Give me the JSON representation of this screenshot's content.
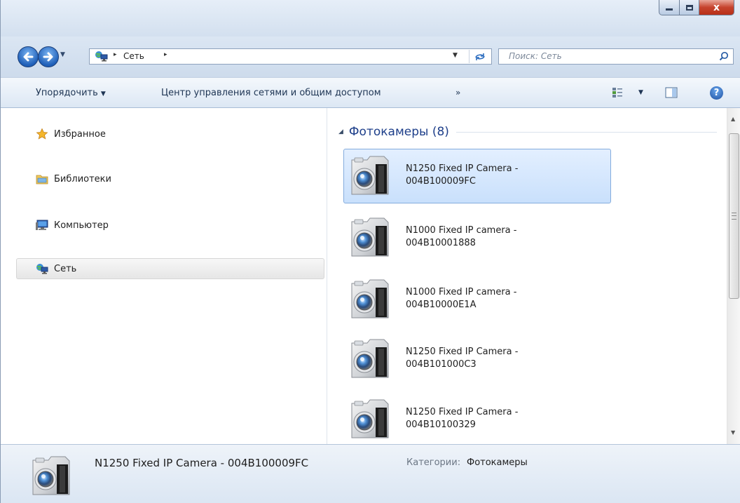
{
  "window": {
    "caption": {
      "minimize": "minimize",
      "maximize": "maximize",
      "close": "x"
    }
  },
  "navigation": {
    "back_icon": "arrow-left-icon",
    "forward_icon": "arrow-right-icon",
    "address": {
      "location": "Сеть",
      "separator": "▸"
    },
    "search": {
      "placeholder": "Поиск: Сеть"
    }
  },
  "toolbar": {
    "organize_label": "Упорядочить",
    "organize_arrow": "▼",
    "network_center_label": "Центр управления сетями и общим доступом",
    "more_label": "»",
    "view_arrow": "▼",
    "help_label": "?"
  },
  "nav_pane": {
    "items": [
      {
        "label": "Избранное",
        "icon": "star-icon"
      },
      {
        "label": "Библиотеки",
        "icon": "library-folder-icon"
      },
      {
        "label": "Компьютер",
        "icon": "computer-icon"
      },
      {
        "label": "Сеть",
        "icon": "network-icon",
        "selected": true
      }
    ]
  },
  "content": {
    "group": {
      "collapse_glyph": "◢",
      "title": "Фотокамеры (8)"
    },
    "items": [
      {
        "line1": "N1250 Fixed IP Camera -",
        "line2": "004B100009FC",
        "selected": true
      },
      {
        "line1": "N1000 Fixed IP camera -",
        "line2": "004B10001888",
        "selected": false
      },
      {
        "line1": "N1000 Fixed IP camera -",
        "line2": "004B10000E1A",
        "selected": false
      },
      {
        "line1": "N1250 Fixed IP Camera -",
        "line2": "004B101000C3",
        "selected": false
      },
      {
        "line1": "N1250 Fixed IP Camera -",
        "line2": "004B10100329",
        "selected": false
      }
    ]
  },
  "scrollbar": {
    "up": "▲",
    "down": "▼"
  },
  "details": {
    "name": "N1250 Fixed IP Camera - 004B100009FC",
    "category_label": "Категории:",
    "category_value": "Фотокамеры"
  },
  "colors": {
    "selection": "#cce2fc",
    "selection_border": "#84acdd",
    "group_title": "#1e3f8a",
    "chrome": "#d8e4f2"
  }
}
